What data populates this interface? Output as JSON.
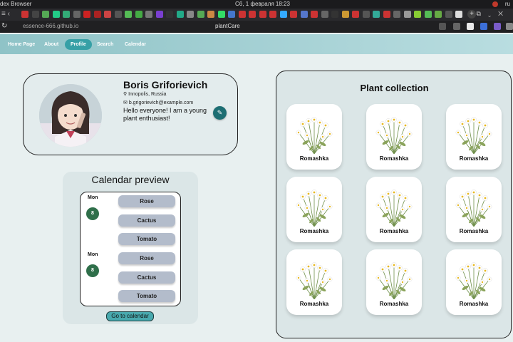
{
  "os": {
    "app_name": "dex Browser",
    "datetime": "Сб, 1 февраля   18:23",
    "locale": "ru"
  },
  "browser": {
    "url": "essence-666.github.io",
    "page_title": "plantCare"
  },
  "nav": {
    "items": [
      {
        "label": "Home Page",
        "active": false
      },
      {
        "label": "About",
        "active": false
      },
      {
        "label": "Profile",
        "active": true
      },
      {
        "label": "Search",
        "active": false
      },
      {
        "label": "Calendar",
        "active": false
      }
    ]
  },
  "profile": {
    "name": "Boris Griforievich",
    "location": "Innopolis, Russia",
    "email": "b.grigorievich@example.com",
    "bio": "Hello everyone! I am a young plant enthusiast!",
    "location_icon": "map-pin-icon",
    "email_icon": "envelope-icon",
    "edit_icon": "pencil-icon"
  },
  "calendar_preview": {
    "title": "Calendar preview",
    "days": [
      {
        "day": "Mon",
        "date": "8",
        "plants": [
          "Rose",
          "Cactus",
          "Tomato"
        ]
      },
      {
        "day": "Mon",
        "date": "8",
        "plants": [
          "Rose",
          "Cactus",
          "Tomato"
        ]
      }
    ],
    "button_label": "Go to calendar"
  },
  "collection": {
    "title": "Plant collection",
    "plants": [
      "Romashka",
      "Romashka",
      "Romashka",
      "Romashka",
      "Romashka",
      "Romashka",
      "Romashka",
      "Romashka",
      "Romashka"
    ]
  },
  "colors": {
    "accent": "#36a0a6",
    "day_badge": "#2f6f4a",
    "pill": "#b3bccb",
    "edit_button": "#1d6e73"
  }
}
